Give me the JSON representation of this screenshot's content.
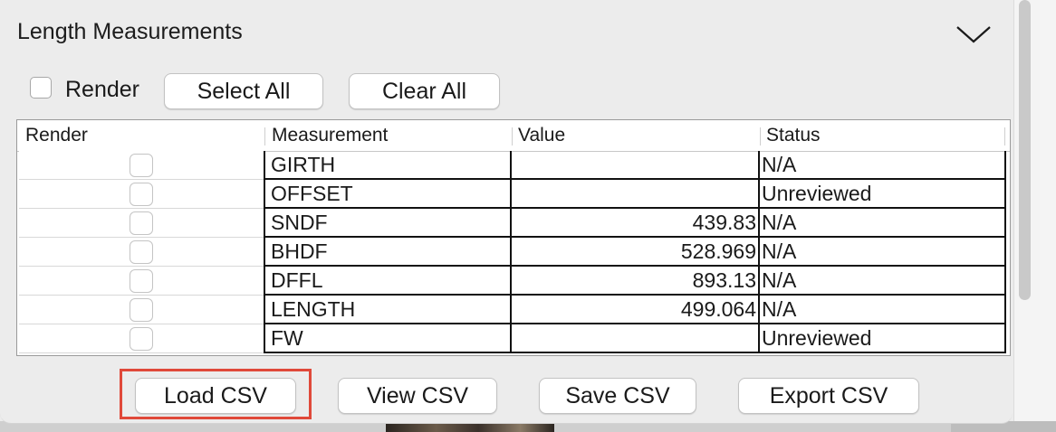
{
  "panel": {
    "title": "Length Measurements",
    "render_label": "Render",
    "select_all_label": "Select All",
    "clear_all_label": "Clear All"
  },
  "table": {
    "columns": [
      "Render",
      "Measurement",
      "Value",
      "Status"
    ],
    "rows": [
      {
        "measurement": "GIRTH",
        "value": "",
        "status": "N/A"
      },
      {
        "measurement": "OFFSET",
        "value": "",
        "status": "Unreviewed"
      },
      {
        "measurement": "SNDF",
        "value": "439.83",
        "status": "N/A"
      },
      {
        "measurement": "BHDF",
        "value": "528.969",
        "status": "N/A"
      },
      {
        "measurement": "DFFL",
        "value": "893.13",
        "status": "N/A"
      },
      {
        "measurement": "LENGTH",
        "value": "499.064",
        "status": "N/A"
      },
      {
        "measurement": "FW",
        "value": "",
        "status": "Unreviewed"
      }
    ]
  },
  "footer": {
    "load_csv": "Load CSV",
    "view_csv": "View CSV",
    "save_csv": "Save CSV",
    "export_csv": "Export CSV"
  },
  "colors": {
    "panel_bg": "#ececec",
    "highlight": "#e0493a"
  },
  "icons": {
    "collapse": "chevron-down-icon"
  }
}
